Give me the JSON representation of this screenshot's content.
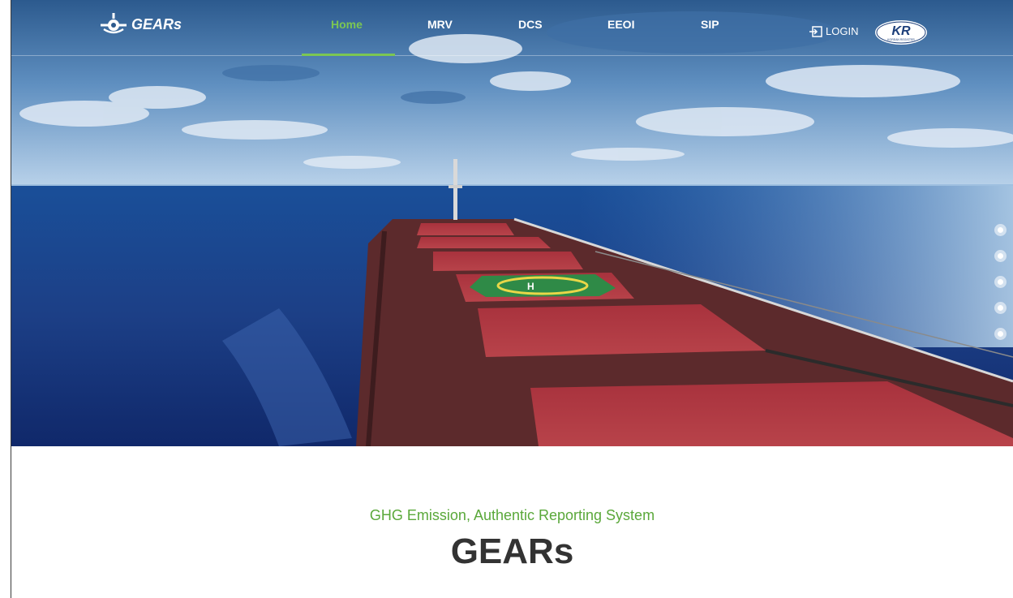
{
  "brand": {
    "logo_text": "GEARs",
    "partner_badge_text": "KR",
    "partner_badge_subtext": "KOREAN REGISTER"
  },
  "nav": {
    "items": [
      {
        "label": "Home",
        "active": true
      },
      {
        "label": "MRV",
        "active": false
      },
      {
        "label": "DCS",
        "active": false
      },
      {
        "label": "EEOI",
        "active": false
      },
      {
        "label": "SIP",
        "active": false
      }
    ],
    "login_label": "LOGIN",
    "active_color": "#7cc653"
  },
  "hero": {
    "slide_count": 5
  },
  "intro": {
    "tagline": "GHG Emission, Authentic Reporting System",
    "title": "GEARs",
    "tagline_color": "#5aa83a"
  }
}
